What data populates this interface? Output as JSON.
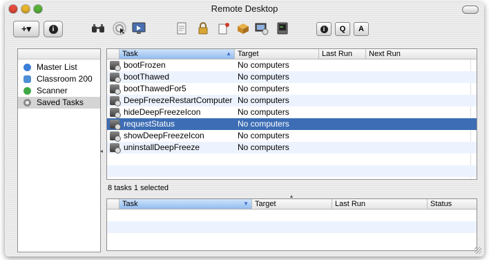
{
  "window": {
    "title": "Remote Desktop"
  },
  "toolbar": {
    "add_label": "+▾",
    "info_label": "i",
    "buttons": [
      "binoculars-icon",
      "observe-icon",
      "control-screen-icon",
      "report-icon",
      "lock-icon",
      "send-message-icon",
      "install-package-icon",
      "copy-items-icon",
      "unix-command-icon"
    ],
    "right": {
      "info": "i",
      "spotlight": "Q",
      "find": "A"
    }
  },
  "sidebar": {
    "items": [
      {
        "label": "Master List",
        "icon": "globe-icon",
        "color": "#3b7fd8"
      },
      {
        "label": "Classroom 200",
        "icon": "classroom-icon",
        "color": "#4d90d6"
      },
      {
        "label": "Scanner",
        "icon": "scanner-icon",
        "color": "#3fa845"
      },
      {
        "label": "Saved Tasks",
        "icon": "gear-icon",
        "color": "#8a8a8a"
      }
    ]
  },
  "tasks_table": {
    "columns": [
      "Task",
      "Target",
      "Last Run",
      "Next Run"
    ],
    "rows": [
      {
        "task": "bootFrozen",
        "target": "No computers"
      },
      {
        "task": "bootThawed",
        "target": "No computers"
      },
      {
        "task": "bootThawedFor5",
        "target": "No computers"
      },
      {
        "task": "DeepFreezeRestartComputer",
        "target": "No computers"
      },
      {
        "task": "hideDeepFreezeIcon",
        "target": "No computers"
      },
      {
        "task": "requestStatus",
        "target": "No computers"
      },
      {
        "task": "showDeepFreezeIcon",
        "target": "No computers"
      },
      {
        "task": "uninstallDeepFreeze",
        "target": "No computers"
      }
    ],
    "selected_index": 5
  },
  "status": {
    "text": "8 tasks  1 selected"
  },
  "bottom_table": {
    "columns": [
      "Task",
      "Target",
      "Last Run",
      "Status"
    ]
  }
}
